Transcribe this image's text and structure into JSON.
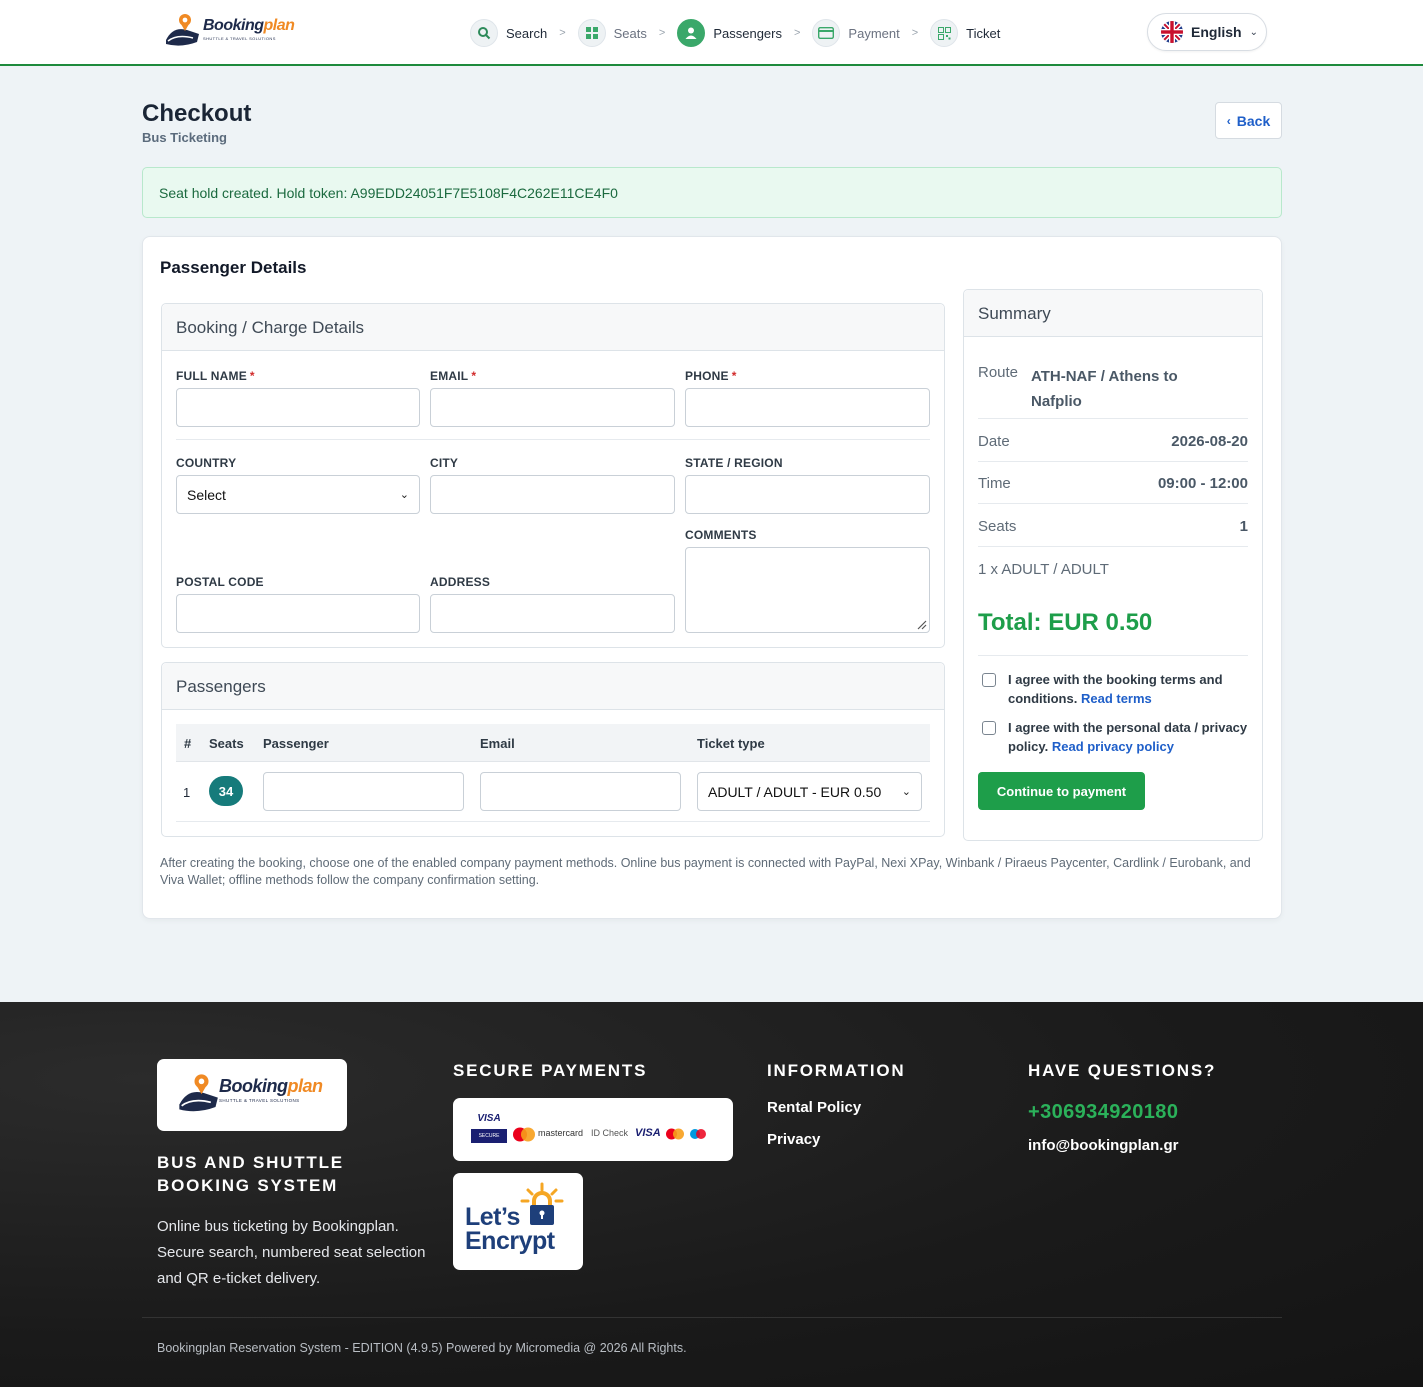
{
  "header": {
    "logo": {
      "name_a": "Booking",
      "name_b": "plan",
      "tagline": "SHUTTLE & TRAVEL SOLUTIONS"
    },
    "steps": [
      {
        "label": "Search",
        "icon": "search-icon",
        "state": "done"
      },
      {
        "label": "Seats",
        "icon": "grid-icon",
        "state": "done"
      },
      {
        "label": "Passengers",
        "icon": "user-icon",
        "state": "active"
      },
      {
        "label": "Payment",
        "icon": "card-icon",
        "state": "pending"
      },
      {
        "label": "Ticket",
        "icon": "qr-icon",
        "state": "pending"
      }
    ],
    "step_separator": ">",
    "language": "English"
  },
  "page": {
    "title": "Checkout",
    "subtitle": "Bus Ticketing",
    "back_label": "Back",
    "alert": "Seat hold created. Hold token: A99EDD24051F7E5108F4C262E11CE4F0"
  },
  "passenger_details": {
    "title": "Passenger Details",
    "booking_panel_title": "Booking / Charge Details",
    "fields": {
      "full_name": "FULL NAME",
      "email": "EMAIL",
      "phone": "PHONE",
      "country": "COUNTRY",
      "country_value": "Select",
      "city": "CITY",
      "state": "STATE / REGION",
      "comments": "COMMENTS",
      "postal": "POSTAL CODE",
      "address": "ADDRESS",
      "required_mark": "*"
    },
    "passengers_panel_title": "Passengers",
    "table": {
      "headers": [
        "#",
        "Seats",
        "Passenger",
        "Email",
        "Ticket type"
      ],
      "rows": [
        {
          "index": "1",
          "seat": "34",
          "ticket_type": "ADULT / ADULT - EUR 0.50"
        }
      ]
    },
    "note": "After creating the booking, choose one of the enabled company payment methods. Online bus payment is connected with PayPal, Nexi XPay, Winbank / Piraeus Paycenter, Cardlink / Eurobank, and Viva Wallet; offline methods follow the company confirmation setting."
  },
  "summary": {
    "title": "Summary",
    "route_label": "Route",
    "route_value_1": "ATH-NAF / Athens to",
    "route_value_2": "Nafplio",
    "date_label": "Date",
    "date_value": "2026-08-20",
    "time_label": "Time",
    "time_value": "09:00 - 12:00",
    "seats_label": "Seats",
    "seats_value": "1",
    "ticket_line": "1 x ADULT / ADULT",
    "total": "Total: EUR 0.50",
    "terms_text_1": "I agree with the booking terms and",
    "terms_text_2": "conditions.",
    "terms_link": "Read terms",
    "privacy_text_1": "I agree with the personal data / privacy",
    "privacy_text_2": "policy.",
    "privacy_link": "Read privacy policy",
    "continue_label": "Continue to payment"
  },
  "footer": {
    "system_title_1": "BUS AND SHUTTLE",
    "system_title_2": "BOOKING SYSTEM",
    "description": "Online bus ticketing by Bookingplan. Secure search, numbered seat selection and QR e-ticket delivery.",
    "secure_payments_title": "SECURE PAYMENTS",
    "payment_badges": {
      "visa_secure_top": "VISA",
      "visa_secure_bottom": "SECURE",
      "mc_id_check": "mastercard",
      "id_check": "ID Check",
      "visa": "VISA"
    },
    "letsencrypt_1": "Let’s",
    "letsencrypt_2": "Encrypt",
    "information_title": "INFORMATION",
    "links": [
      "Rental Policy",
      "Privacy"
    ],
    "questions_title": "HAVE QUESTIONS?",
    "phone": "+306934920180",
    "email": "info@bookingplan.gr",
    "copyright": "Bookingplan Reservation System - EDITION (4.9.5) Powered by Micromedia @ 2026 All Rights."
  },
  "colors": {
    "accent_green": "#1e9e4a",
    "link_blue": "#1f5fc9",
    "seat_teal": "#167b7b",
    "required_red": "#d12b2b"
  }
}
